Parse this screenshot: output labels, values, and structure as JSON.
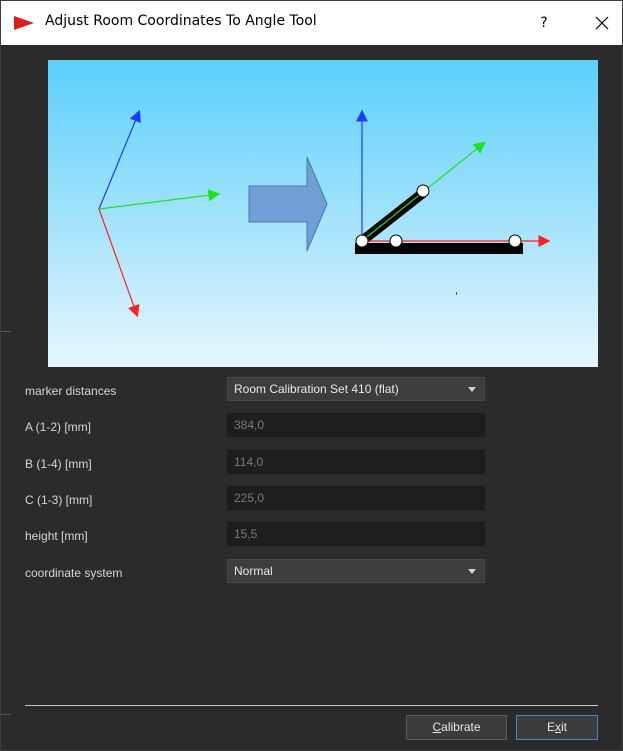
{
  "window": {
    "title": "Adjust Room Coordinates To Angle Tool",
    "help_label": "?",
    "close_icon": "close-icon"
  },
  "colors": {
    "axis_x": "#ff2020",
    "axis_y": "#1a3cff",
    "axis_z": "#20e020",
    "arrow_fill": "#6f9fd4",
    "window_bg": "#2b2b2b"
  },
  "form": {
    "marker_distances": {
      "label": "marker distances",
      "value": "Room Calibration Set 410 (flat)"
    },
    "a": {
      "label": "A (1-2) [mm]",
      "value": "384,0"
    },
    "b": {
      "label": "B (1-4) [mm]",
      "value": "114,0"
    },
    "c": {
      "label": "C (1-3) [mm]",
      "value": "225,0"
    },
    "height": {
      "label": "height [mm]",
      "value": "15,5"
    },
    "coordinate_system": {
      "label": "coordinate system",
      "value": "Normal"
    }
  },
  "buttons": {
    "calibrate_prefix": "C",
    "calibrate_rest": "alibrate",
    "exit_prefix": "E",
    "exit_mid": "x",
    "exit_rest": "it"
  }
}
